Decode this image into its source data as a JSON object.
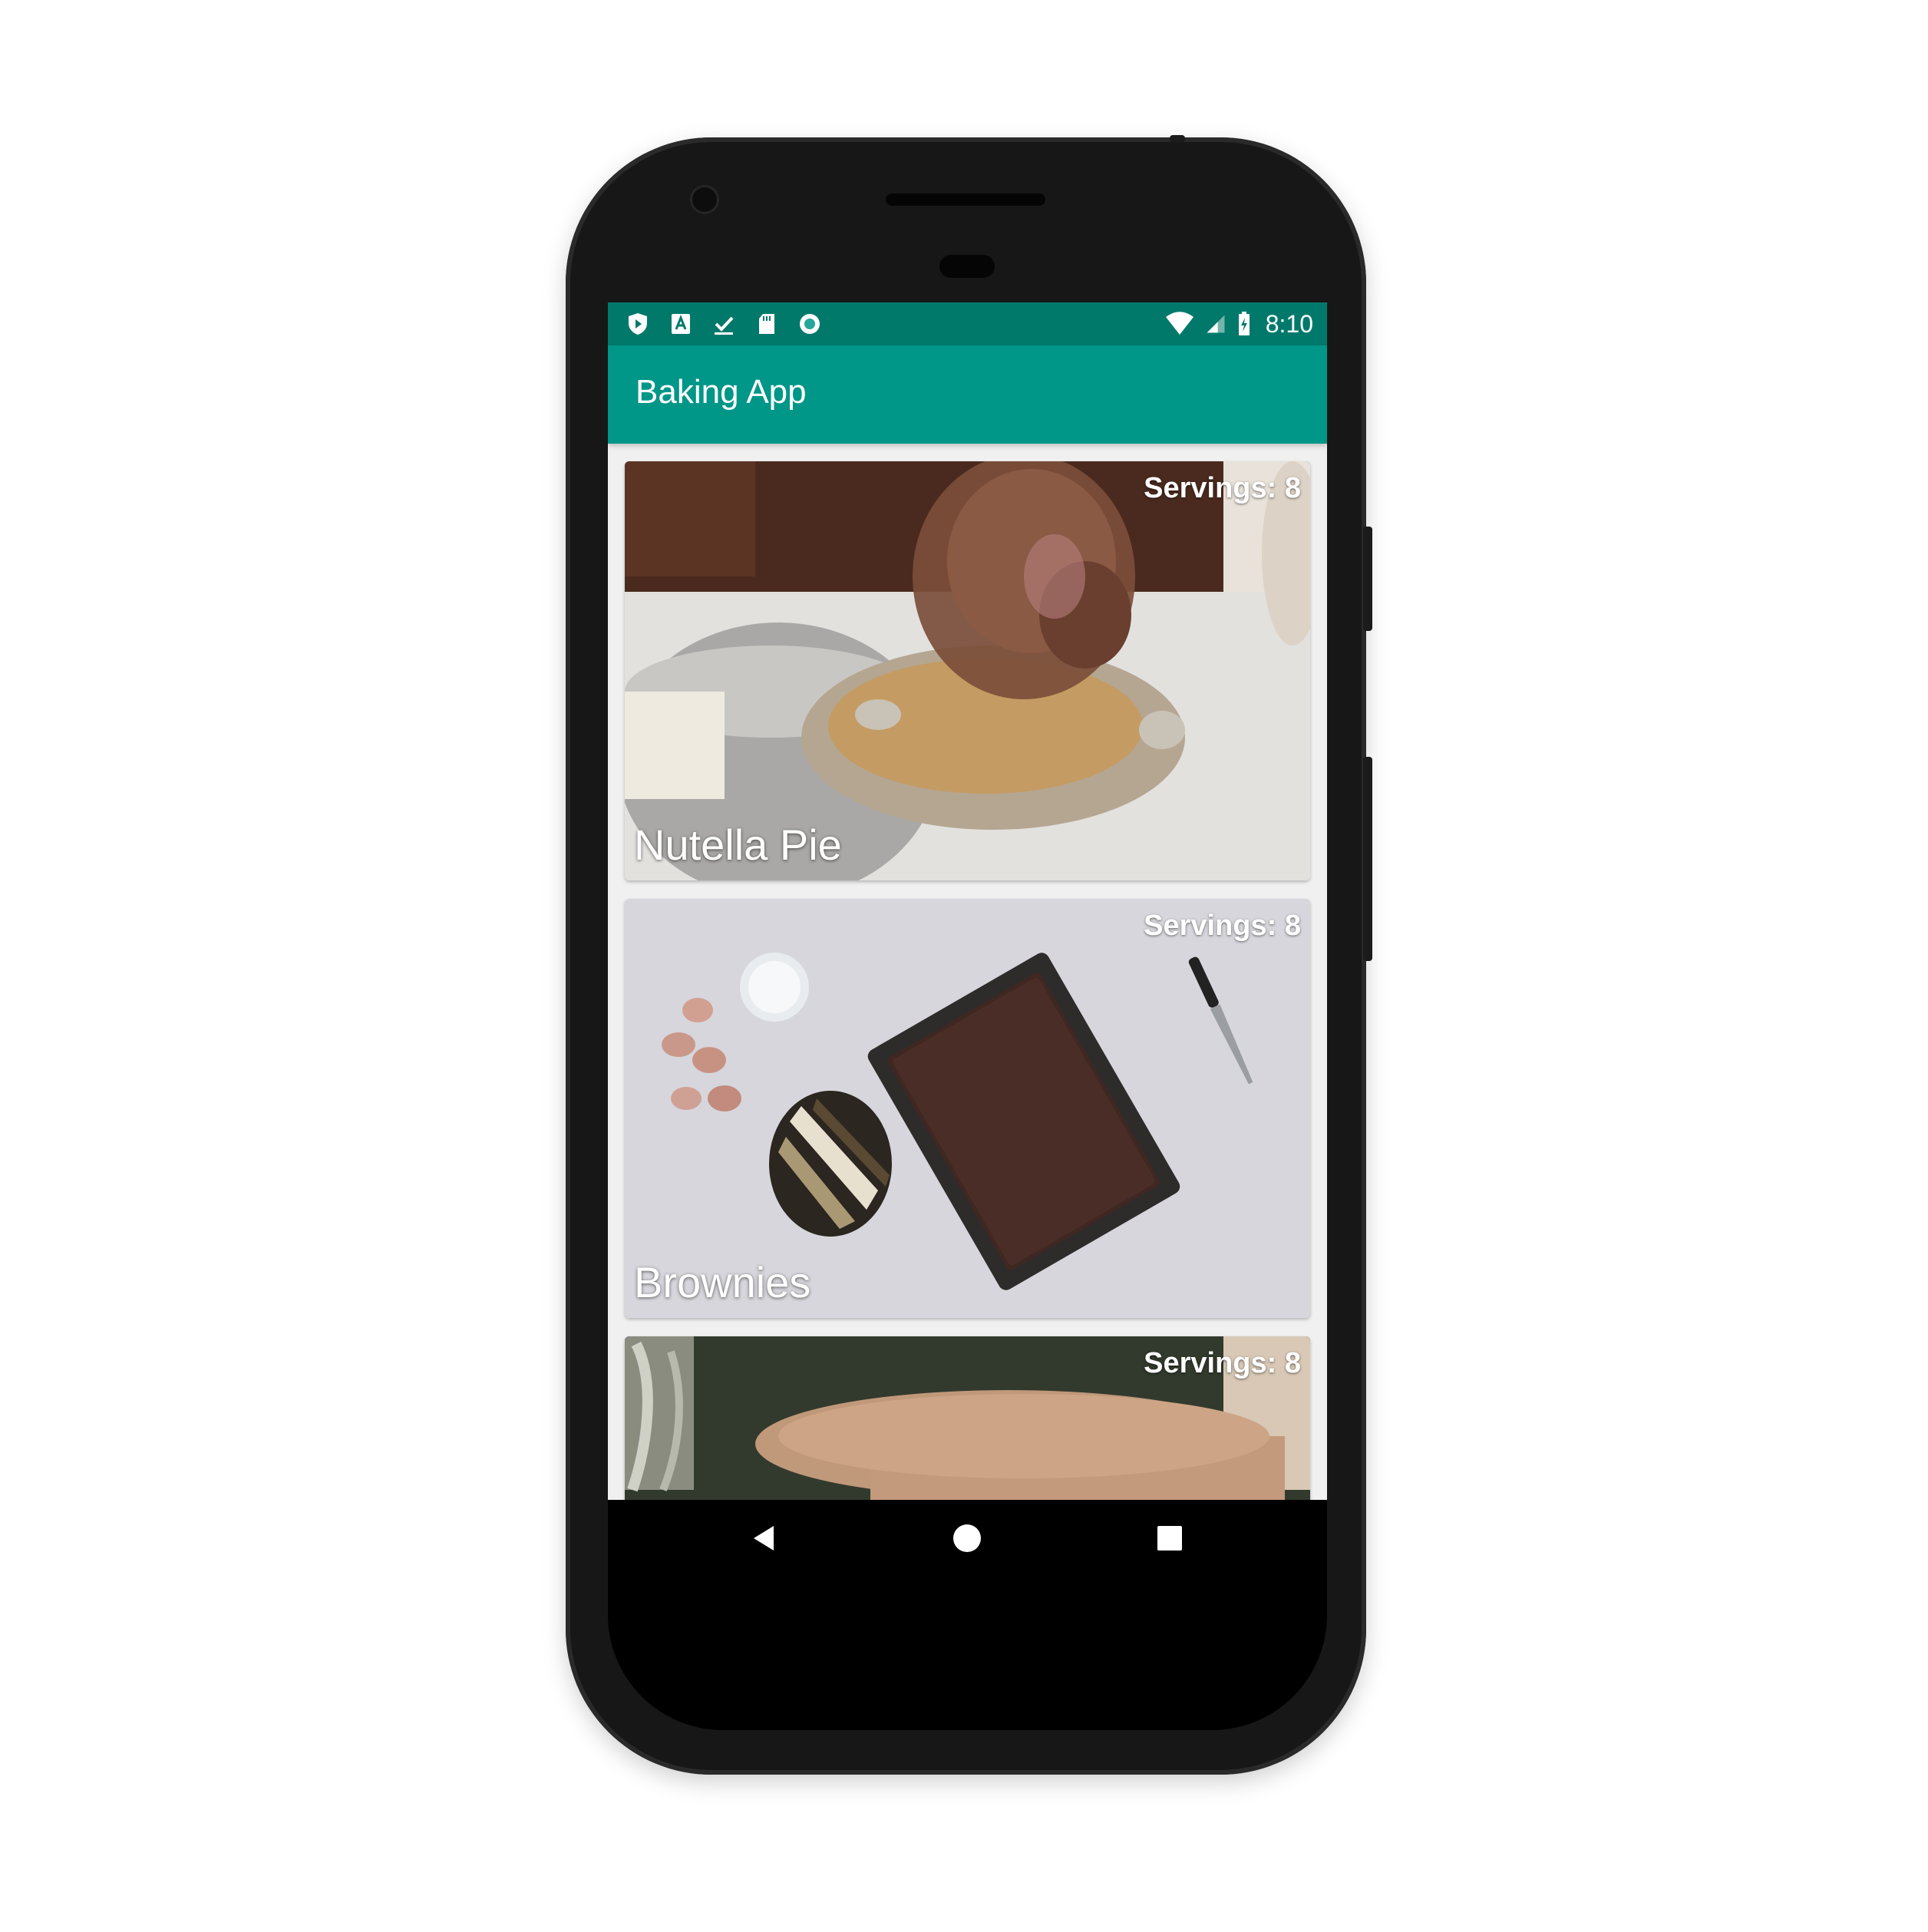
{
  "status_bar": {
    "time": "8:10",
    "left_icons": [
      "shield-play-icon",
      "font-a-icon",
      "download-done-icon",
      "sd-card-icon",
      "record-icon"
    ],
    "right_icons": [
      "wifi-icon",
      "cell-signal-icon",
      "battery-charging-icon"
    ]
  },
  "app_bar": {
    "title": "Baking App"
  },
  "recipes": [
    {
      "name": "Nutella Pie",
      "servings": "Servings: 8"
    },
    {
      "name": "Brownies",
      "servings": "Servings: 8"
    },
    {
      "name": "",
      "servings": "Servings: 8"
    }
  ],
  "nav_bar": {
    "icons": [
      "back-icon",
      "home-icon",
      "recents-icon"
    ]
  },
  "colors": {
    "primary": "#009688",
    "primary_dark": "#00796b",
    "list_background": "#f0f0f0"
  }
}
